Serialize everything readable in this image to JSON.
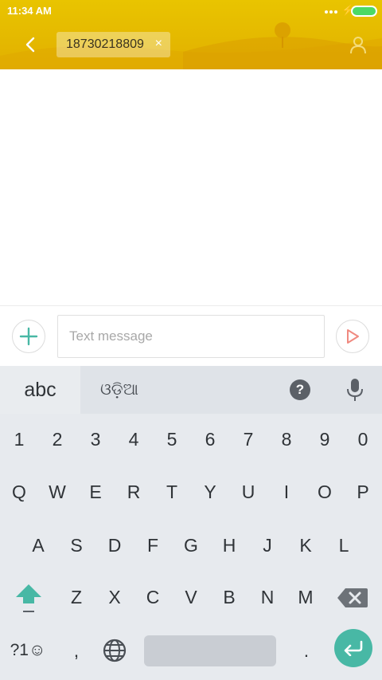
{
  "status": {
    "time": "11:34 AM",
    "battery_color": "#4cd964"
  },
  "header": {
    "back_icon": "chevron-left-icon",
    "recipient": "18730218809",
    "remove_icon": "close-icon",
    "remove_symbol": "×",
    "contact_icon": "person-icon",
    "background_color": "#e6bb00"
  },
  "compose": {
    "attach_icon": "plus-icon",
    "placeholder": "Text message",
    "value": "",
    "send_icon": "send-icon",
    "accent_color": "#48b8a5",
    "send_color": "#f08a80"
  },
  "keyboard": {
    "languages": [
      {
        "label": "abc",
        "active": true
      },
      {
        "label": "ଓଡ଼ିଆ",
        "active": false
      }
    ],
    "help_label": "?",
    "mic_icon": "microphone-icon",
    "digits": [
      "1",
      "2",
      "3",
      "4",
      "5",
      "6",
      "7",
      "8",
      "9",
      "0"
    ],
    "row1": [
      "Q",
      "W",
      "E",
      "R",
      "T",
      "Y",
      "U",
      "I",
      "O",
      "P"
    ],
    "row2": [
      "A",
      "S",
      "D",
      "F",
      "G",
      "H",
      "J",
      "K",
      "L"
    ],
    "row3": [
      "Z",
      "X",
      "C",
      "V",
      "B",
      "N",
      "M"
    ],
    "shift_icon": "shift-arrow-icon",
    "backspace_icon": "backspace-icon",
    "symbols_label": "?1☺",
    "comma": ",",
    "globe_icon": "globe-icon",
    "period": ".",
    "enter_icon": "enter-icon"
  }
}
